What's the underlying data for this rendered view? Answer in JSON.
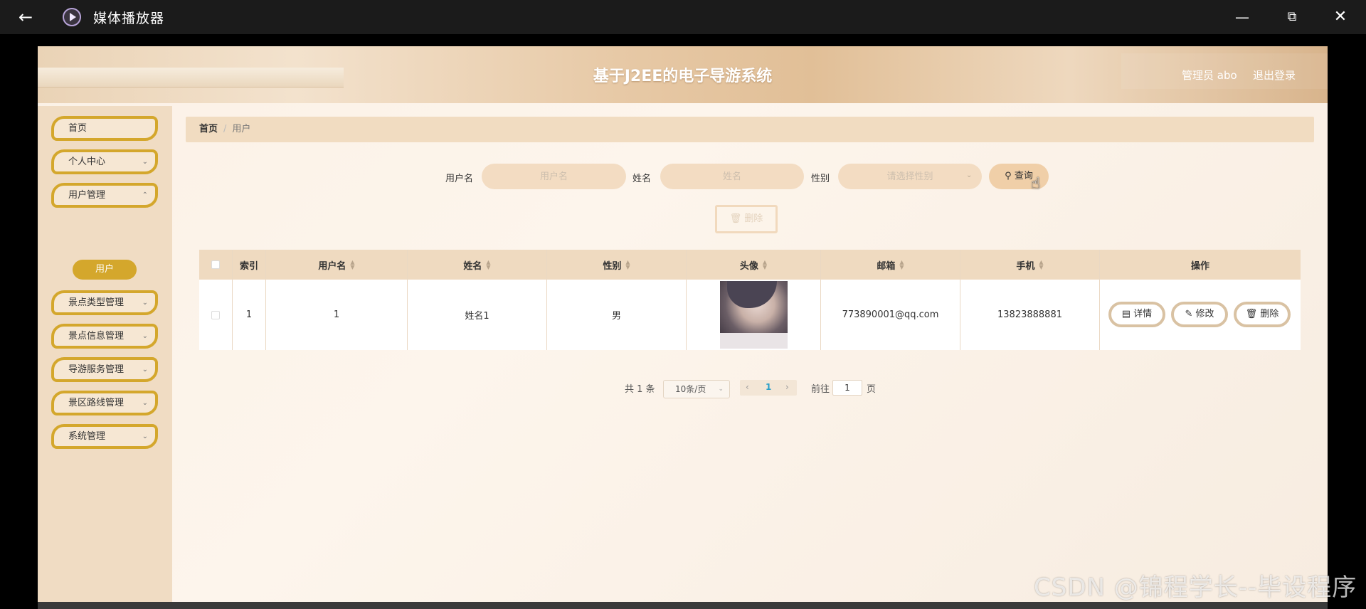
{
  "player": {
    "title": "媒体播放器",
    "back_icon": "back-arrow-icon",
    "controls": [
      "minimize-icon",
      "restore-icon",
      "close-icon"
    ]
  },
  "app": {
    "title": "基于J2EE的电子导游系统",
    "user": "管理员 abo",
    "logout": "退出登录"
  },
  "sidebar": {
    "items": [
      {
        "label": "首页",
        "expandable": false
      },
      {
        "label": "个人中心",
        "expandable": true
      },
      {
        "label": "用户管理",
        "expandable": true
      },
      {
        "label": "景点类型管理",
        "expandable": true
      },
      {
        "label": "景点信息管理",
        "expandable": true
      },
      {
        "label": "导游服务管理",
        "expandable": true
      },
      {
        "label": "景区路线管理",
        "expandable": true
      },
      {
        "label": "系统管理",
        "expandable": true
      }
    ],
    "sub_active": "用户"
  },
  "breadcrumb": {
    "home": "首页",
    "sep": "/",
    "current": "用户"
  },
  "search": {
    "username_label": "用户名",
    "username_placeholder": "用户名",
    "name_label": "姓名",
    "name_placeholder": "姓名",
    "gender_label": "性别",
    "gender_placeholder": "请选择性别",
    "search_button": "查询",
    "delete_button": "删除"
  },
  "table": {
    "headers": [
      "索引",
      "用户名",
      "姓名",
      "性别",
      "头像",
      "邮箱",
      "手机",
      "操作"
    ],
    "rows": [
      {
        "index": "1",
        "username": "1",
        "name": "姓名1",
        "gender": "男",
        "email": "773890001@qq.com",
        "phone": "13823888881"
      }
    ],
    "actions": {
      "detail": "详情",
      "edit": "修改",
      "delete": "删除"
    }
  },
  "pagination": {
    "total": "共 1 条",
    "page_size": "10条/页",
    "current_page": "1",
    "goto_label": "前往",
    "goto_value": "1",
    "page_suffix": "页"
  },
  "watermark": "CSDN @锦程学长--毕设程序",
  "colors": {
    "accent": "#d4a72c",
    "header_bg": "#efdac0",
    "sidebar_bg": "#f0dcc3"
  }
}
